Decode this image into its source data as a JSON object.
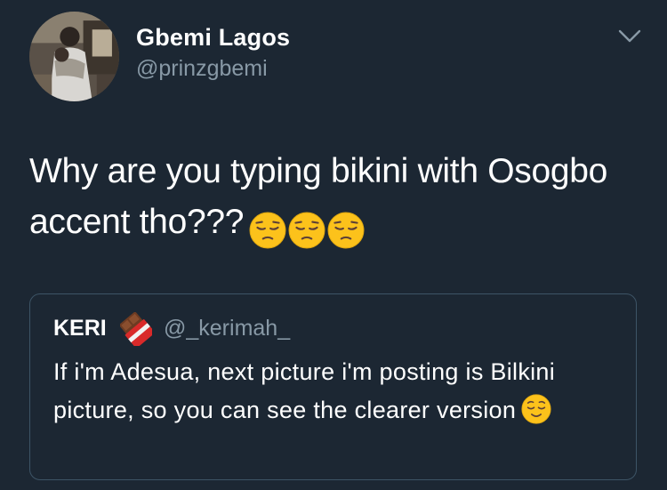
{
  "author": {
    "display_name": "Gbemi Lagos",
    "handle": "@prinzgbemi"
  },
  "tweet": {
    "text": "Why are you typing bikini with Osogbo accent tho???",
    "emoji": [
      "pensive-face",
      "pensive-face",
      "pensive-face"
    ]
  },
  "quoted_tweet": {
    "display_name": "KERI",
    "name_emoji": "chocolate-bar",
    "handle": "@_kerimah_",
    "text": "If i'm Adesua, next picture i'm posting is Bilkini picture, so you can see the clearer version",
    "emoji": "relieved-face"
  },
  "colors": {
    "background": "#1c2733",
    "secondary_text": "#8899a6",
    "border": "#3d5466"
  }
}
